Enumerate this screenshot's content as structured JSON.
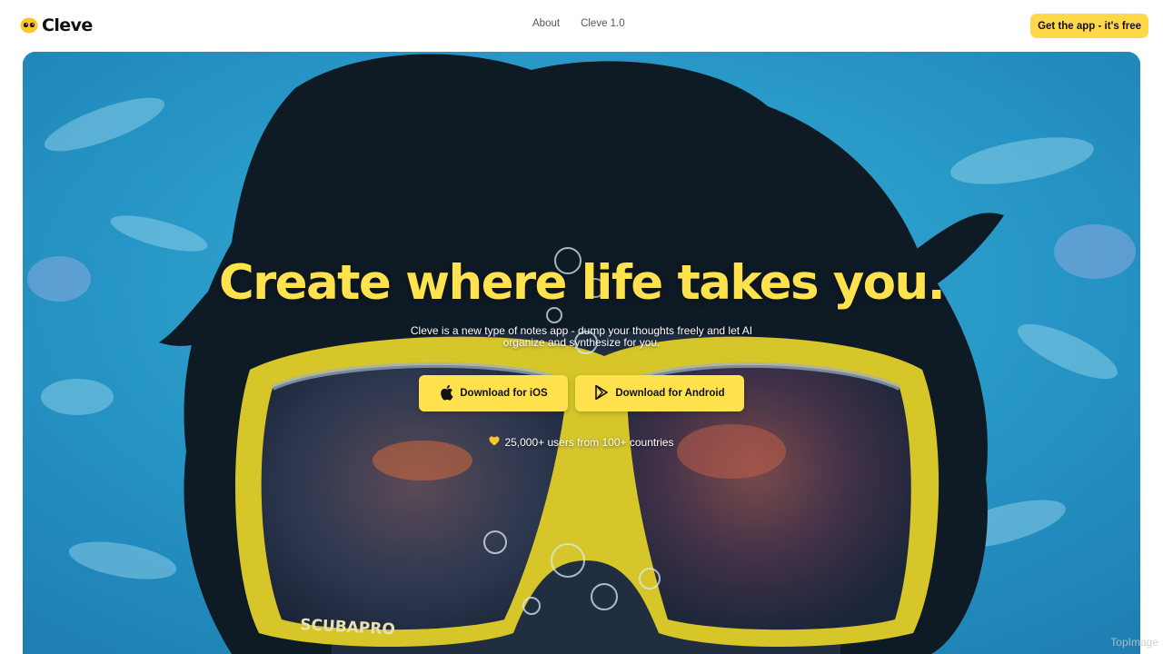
{
  "brand": {
    "name": "Cleve"
  },
  "nav": {
    "items": [
      "About",
      "Cleve 1.0"
    ]
  },
  "header": {
    "cta_label": "Get the app - it's free"
  },
  "hero": {
    "headline": "Create where life takes you.",
    "subtext_line1": "Cleve is a new type of notes app - dump your thoughts freely and let AI",
    "subtext_line2": "organize and synthesize for you.",
    "ios_button": "Download for iOS",
    "android_button": "Download for Android",
    "users_text": "25,000+ users from 100+ countries",
    "image_goggle_text": "SCUBAPRO"
  },
  "watermark": "TopImage",
  "colors": {
    "accent": "#ffe24d",
    "cta": "#ffd84a",
    "water": "#2aa2cf"
  },
  "icons": {
    "logo": "cleve-eyes-icon",
    "ios": "apple-icon",
    "android": "play-store-icon",
    "users": "heart-icon"
  }
}
